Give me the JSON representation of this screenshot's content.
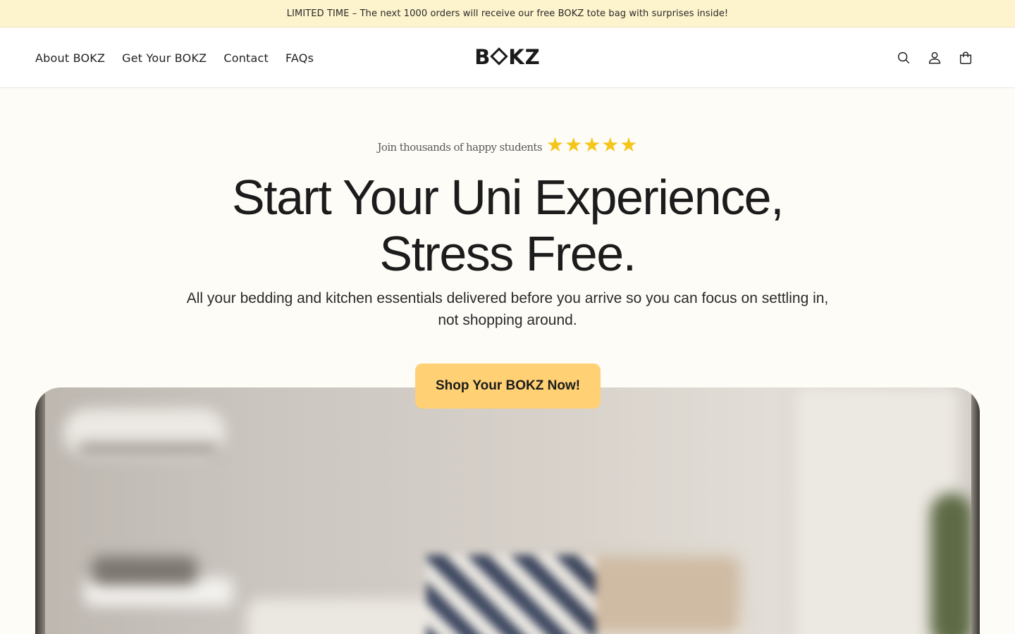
{
  "announcement": {
    "text": "LIMITED TIME – The next 1000 orders will receive our free BOKZ tote bag with surprises inside!"
  },
  "header": {
    "nav": [
      {
        "label": "About BOKZ"
      },
      {
        "label": "Get Your BOKZ"
      },
      {
        "label": "Contact"
      },
      {
        "label": "FAQs"
      }
    ],
    "logo": {
      "left": "B",
      "right": "KZ"
    },
    "icons": [
      "search-icon",
      "account-icon",
      "cart-icon"
    ]
  },
  "hero": {
    "rating_text": "Join thousands of happy students",
    "stars": 5,
    "title_line1": "Start Your Uni Experience,",
    "title_line2": "Stress Free.",
    "subtitle": "All your bedding and kitchen essentials delivered before you arrive so you can focus on settling in, not shopping around.",
    "cta_label": "Shop Your BOKZ Now!"
  },
  "colors": {
    "announcement_bg": "#fdf3cc",
    "page_bg": "#fdfcf7",
    "cta_bg": "#ffd074",
    "star": "#f5c518"
  }
}
